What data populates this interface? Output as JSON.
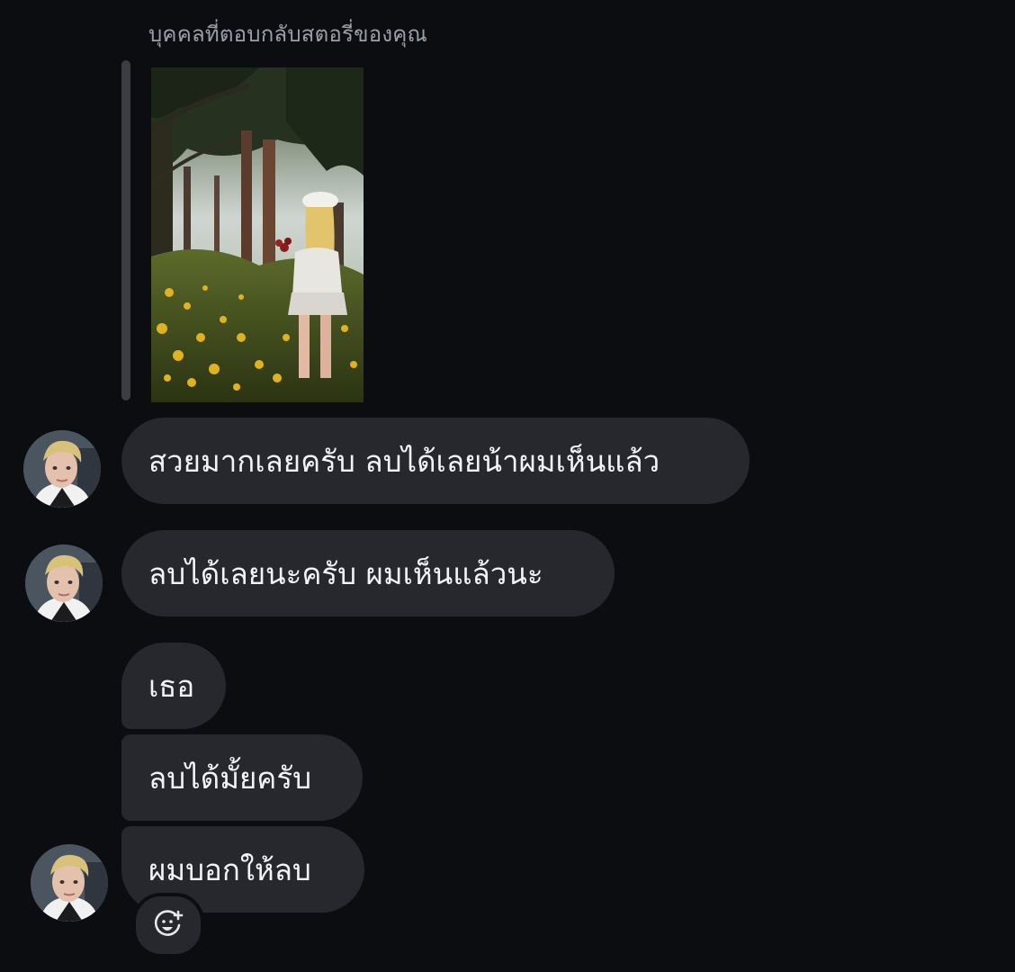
{
  "reply_context": {
    "caption": "บุคคลที่ตอบกลับสตอรี่ของคุณ"
  },
  "messages": [
    {
      "text": "สวยมากเลยครับ ลบได้เลยน้าผมเห็นแล้ว"
    },
    {
      "text": "ลบได้เลยนะครับ ผมเห็นแล้วนะ"
    },
    {
      "text": "เธอ"
    },
    {
      "text": "ลบได้มั้ยครับ"
    },
    {
      "text": "ผมบอกให้ลบ"
    }
  ],
  "icons": {
    "reaction": "add-reaction-smiley-icon"
  },
  "colors": {
    "background": "#0b0d11",
    "bubble": "#26282e",
    "text": "#f2f3f5",
    "caption": "#9aa0a8"
  }
}
